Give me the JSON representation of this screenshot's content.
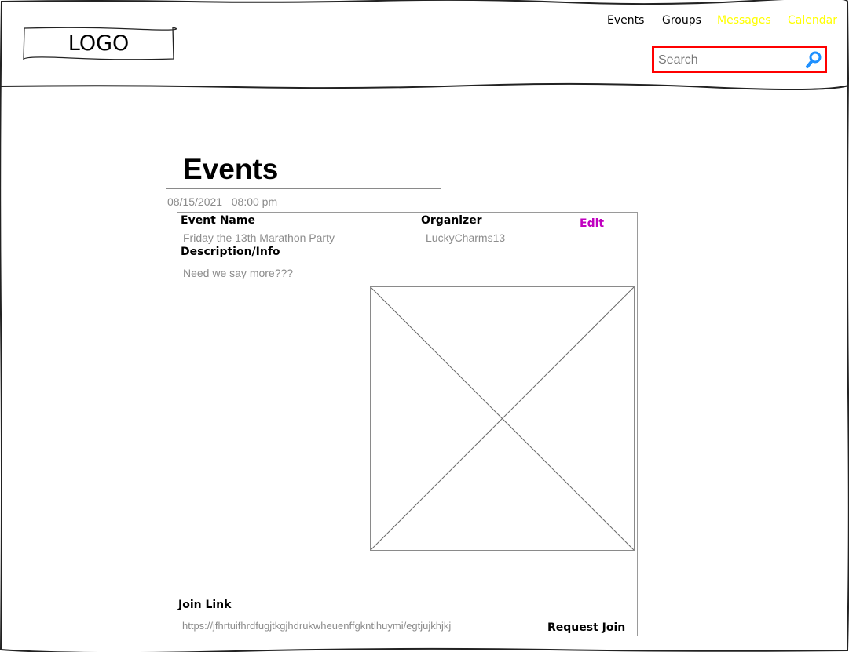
{
  "header": {
    "logo_text": "LOGO",
    "nav": [
      {
        "label": "Events",
        "color": "#000000"
      },
      {
        "label": "Groups",
        "color": "#000000"
      },
      {
        "label": "Messages",
        "color": "#ffff00"
      },
      {
        "label": "Calendar",
        "color": "#ffff00"
      }
    ],
    "search": {
      "placeholder": "Search",
      "value": "",
      "icon": "search-icon",
      "border_color": "#ff0000",
      "icon_color": "#1e90ff"
    }
  },
  "main": {
    "title": "Events",
    "event": {
      "date": "08/15/2021",
      "time": "08:00 pm",
      "event_name_label": "Event Name",
      "event_name": "Friday the 13th Marathon Party",
      "organizer_label": "Organizer",
      "organizer": "LuckyCharms13",
      "edit_label": "Edit",
      "description_label": "Description/Info",
      "description": "Need we say more???",
      "image_icon": "image-placeholder-icon",
      "join_link_label": "Join Link",
      "join_link": "https://jfhrtuifhrdfugjtkgjhdrukwheuenffgkntihuymi/egtjujkhjkj",
      "request_join_label": "Request Join"
    }
  },
  "colors": {
    "accent_edit": "#c000c0",
    "muted_text": "#8c8c8c"
  }
}
